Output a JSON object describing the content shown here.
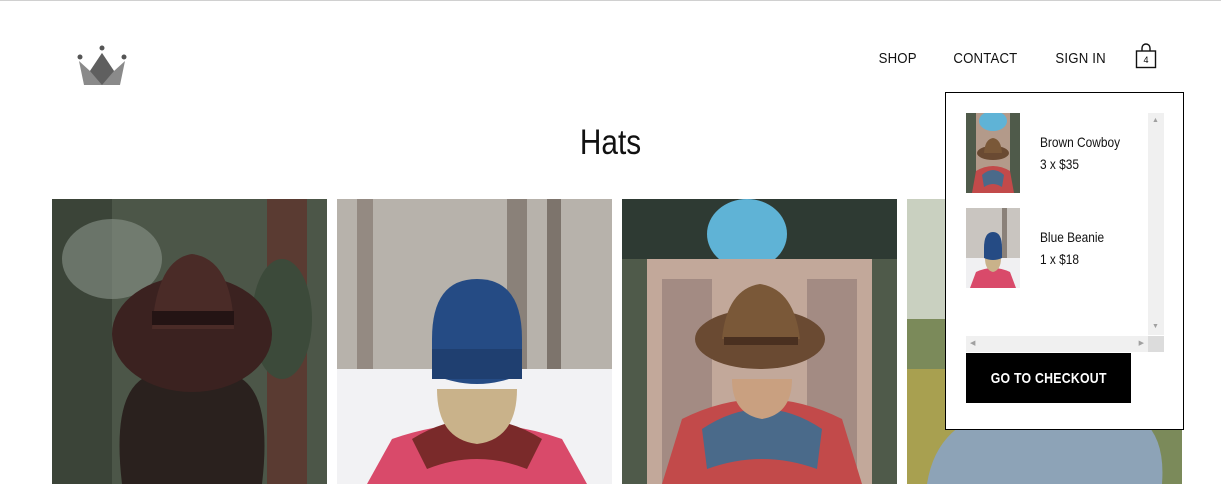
{
  "header": {
    "logo_icon": "crown-icon",
    "nav": [
      {
        "label": "SHOP"
      },
      {
        "label": "CONTACT"
      },
      {
        "label": "SIGN IN"
      }
    ],
    "cart_icon": "shopping-bag-icon",
    "cart_count": "4"
  },
  "main": {
    "title": "Hats",
    "products": [
      {
        "image": "brown-fedora-photo"
      },
      {
        "image": "blue-beanie-photo"
      },
      {
        "image": "brown-cowboy-photo"
      },
      {
        "image": "hat-photo"
      }
    ]
  },
  "cart_dropdown": {
    "items": [
      {
        "name": "Brown Cowboy",
        "qty_price": "3 x $35",
        "thumb": "brown-cowboy-thumbnail"
      },
      {
        "name": "Blue Beanie",
        "qty_price": "1 x $18",
        "thumb": "blue-beanie-thumbnail"
      }
    ],
    "checkout_label": "GO TO CHECKOUT"
  }
}
